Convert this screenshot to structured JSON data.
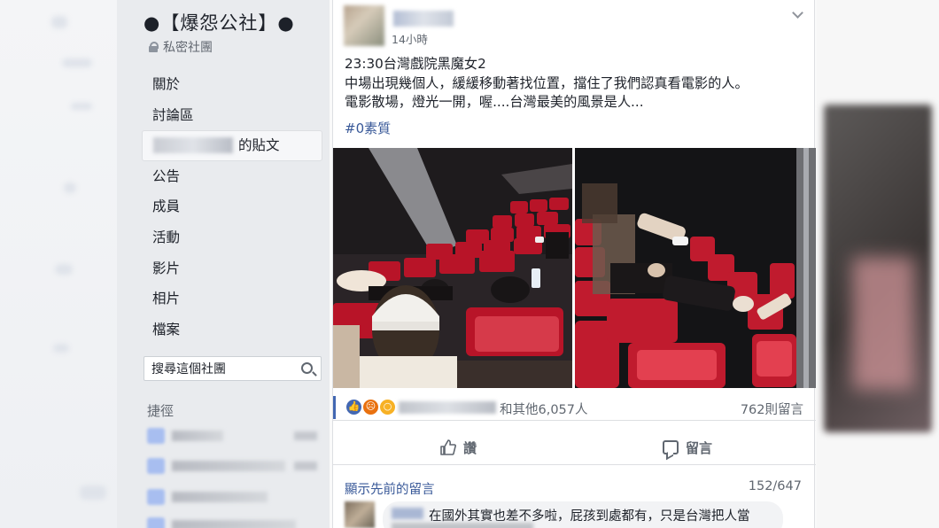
{
  "group": {
    "title": "●【爆怨公社】●",
    "privacy": "私密社團"
  },
  "sidebar": {
    "items": [
      {
        "label": "關於"
      },
      {
        "label": "討論區"
      },
      {
        "label": "的貼文",
        "active": true
      },
      {
        "label": "公告"
      },
      {
        "label": "成員"
      },
      {
        "label": "活動"
      },
      {
        "label": "影片"
      },
      {
        "label": "相片"
      },
      {
        "label": "檔案"
      }
    ],
    "search_placeholder": "搜尋這個社團",
    "shortcuts_heading": "捷徑"
  },
  "post": {
    "timestamp": "14小時",
    "lines": [
      "23:30台灣戲院黑魔女2",
      "中場出現幾個人，緩緩移動著找位置，擋住了我們認真看電影的人。",
      "電影散場，燈光一開，喔....台灣最美的風景是人..."
    ],
    "hashtag": "#0素質",
    "reactions": {
      "icons": [
        "like-icon",
        "angry-icon",
        "wow-icon"
      ],
      "others_text": "和其他6,057人",
      "comment_count": "762則留言"
    },
    "actions": {
      "like_label": "讚",
      "comment_label": "留言"
    },
    "comments": {
      "previous_label": "顯示先前的留言",
      "count": "152/647",
      "first_text": "在國外其實也差不多啦，屁孩到處都有，只是台灣把人當"
    }
  },
  "colors": {
    "link": "#385898",
    "like_blue": "#4267b2",
    "sidebar_bg": "#e9ebee",
    "seat_red": "#c41a2e"
  }
}
